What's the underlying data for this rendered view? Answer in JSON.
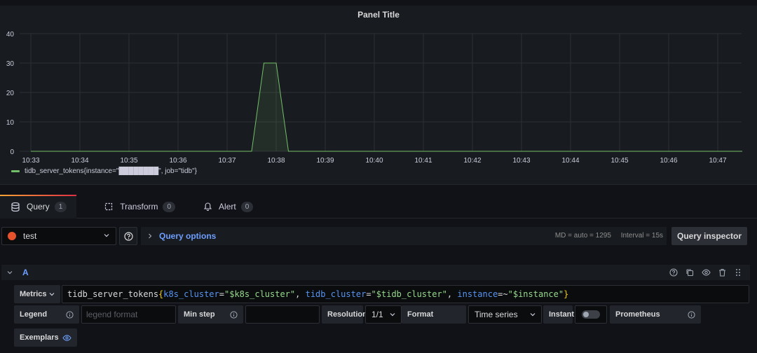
{
  "panel": {
    "title": "Panel Title"
  },
  "chart_data": {
    "type": "area",
    "title": "Panel Title",
    "x_ticks": [
      "10:33",
      "10:34",
      "10:35",
      "10:36",
      "10:37",
      "10:38",
      "10:39",
      "10:40",
      "10:41",
      "10:42",
      "10:43",
      "10:44",
      "10:45",
      "10:46",
      "10:47"
    ],
    "y_ticks": [
      "0",
      "10",
      "20",
      "30",
      "40"
    ],
    "ylim": [
      0,
      40
    ],
    "grid": true,
    "series": [
      {
        "name": "tidb_server_tokens{instance=\"████████\", job=\"tidb\"}",
        "color": "#73bf69",
        "x": [
          "10:33",
          "10:37:30",
          "10:37:45",
          "10:38:00",
          "10:38:15",
          "10:47:30"
        ],
        "y": [
          0,
          0,
          30,
          30,
          0,
          0
        ]
      }
    ]
  },
  "legend": {
    "label": "tidb_server_tokens{instance=\"████████\", job=\"tidb\"}"
  },
  "tabs": [
    {
      "label": "Query",
      "count": "1"
    },
    {
      "label": "Transform",
      "count": "0"
    },
    {
      "label": "Alert",
      "count": "0"
    }
  ],
  "toolbar": {
    "datasource": "test",
    "query_options": "Query options",
    "md": "MD = auto = 1295",
    "interval": "Interval = 15s",
    "inspector": "Query inspector"
  },
  "query": {
    "ref": "A",
    "metrics_label": "Metrics",
    "expr": {
      "metric": "tidb_server_tokens",
      "open": "{",
      "k1": "k8s_cluster",
      "op1": "=",
      "v1": "\"$k8s_cluster\"",
      "sep1": ", ",
      "k2": "tidb_cluster",
      "op2": "=",
      "v2": "\"$tidb_cluster\"",
      "sep2": ", ",
      "k3": "instance",
      "op3": "=~",
      "v3": "\"$instance\"",
      "close": "}"
    },
    "legend_label": "Legend",
    "legend_placeholder": "legend format",
    "minstep_label": "Min step",
    "resolution_label": "Resolution",
    "resolution_value": "1/1",
    "format_label": "Format",
    "format_value": "Time series",
    "instant_label": "Instant",
    "prometheus_label": "Prometheus",
    "exemplars_label": "Exemplars"
  }
}
